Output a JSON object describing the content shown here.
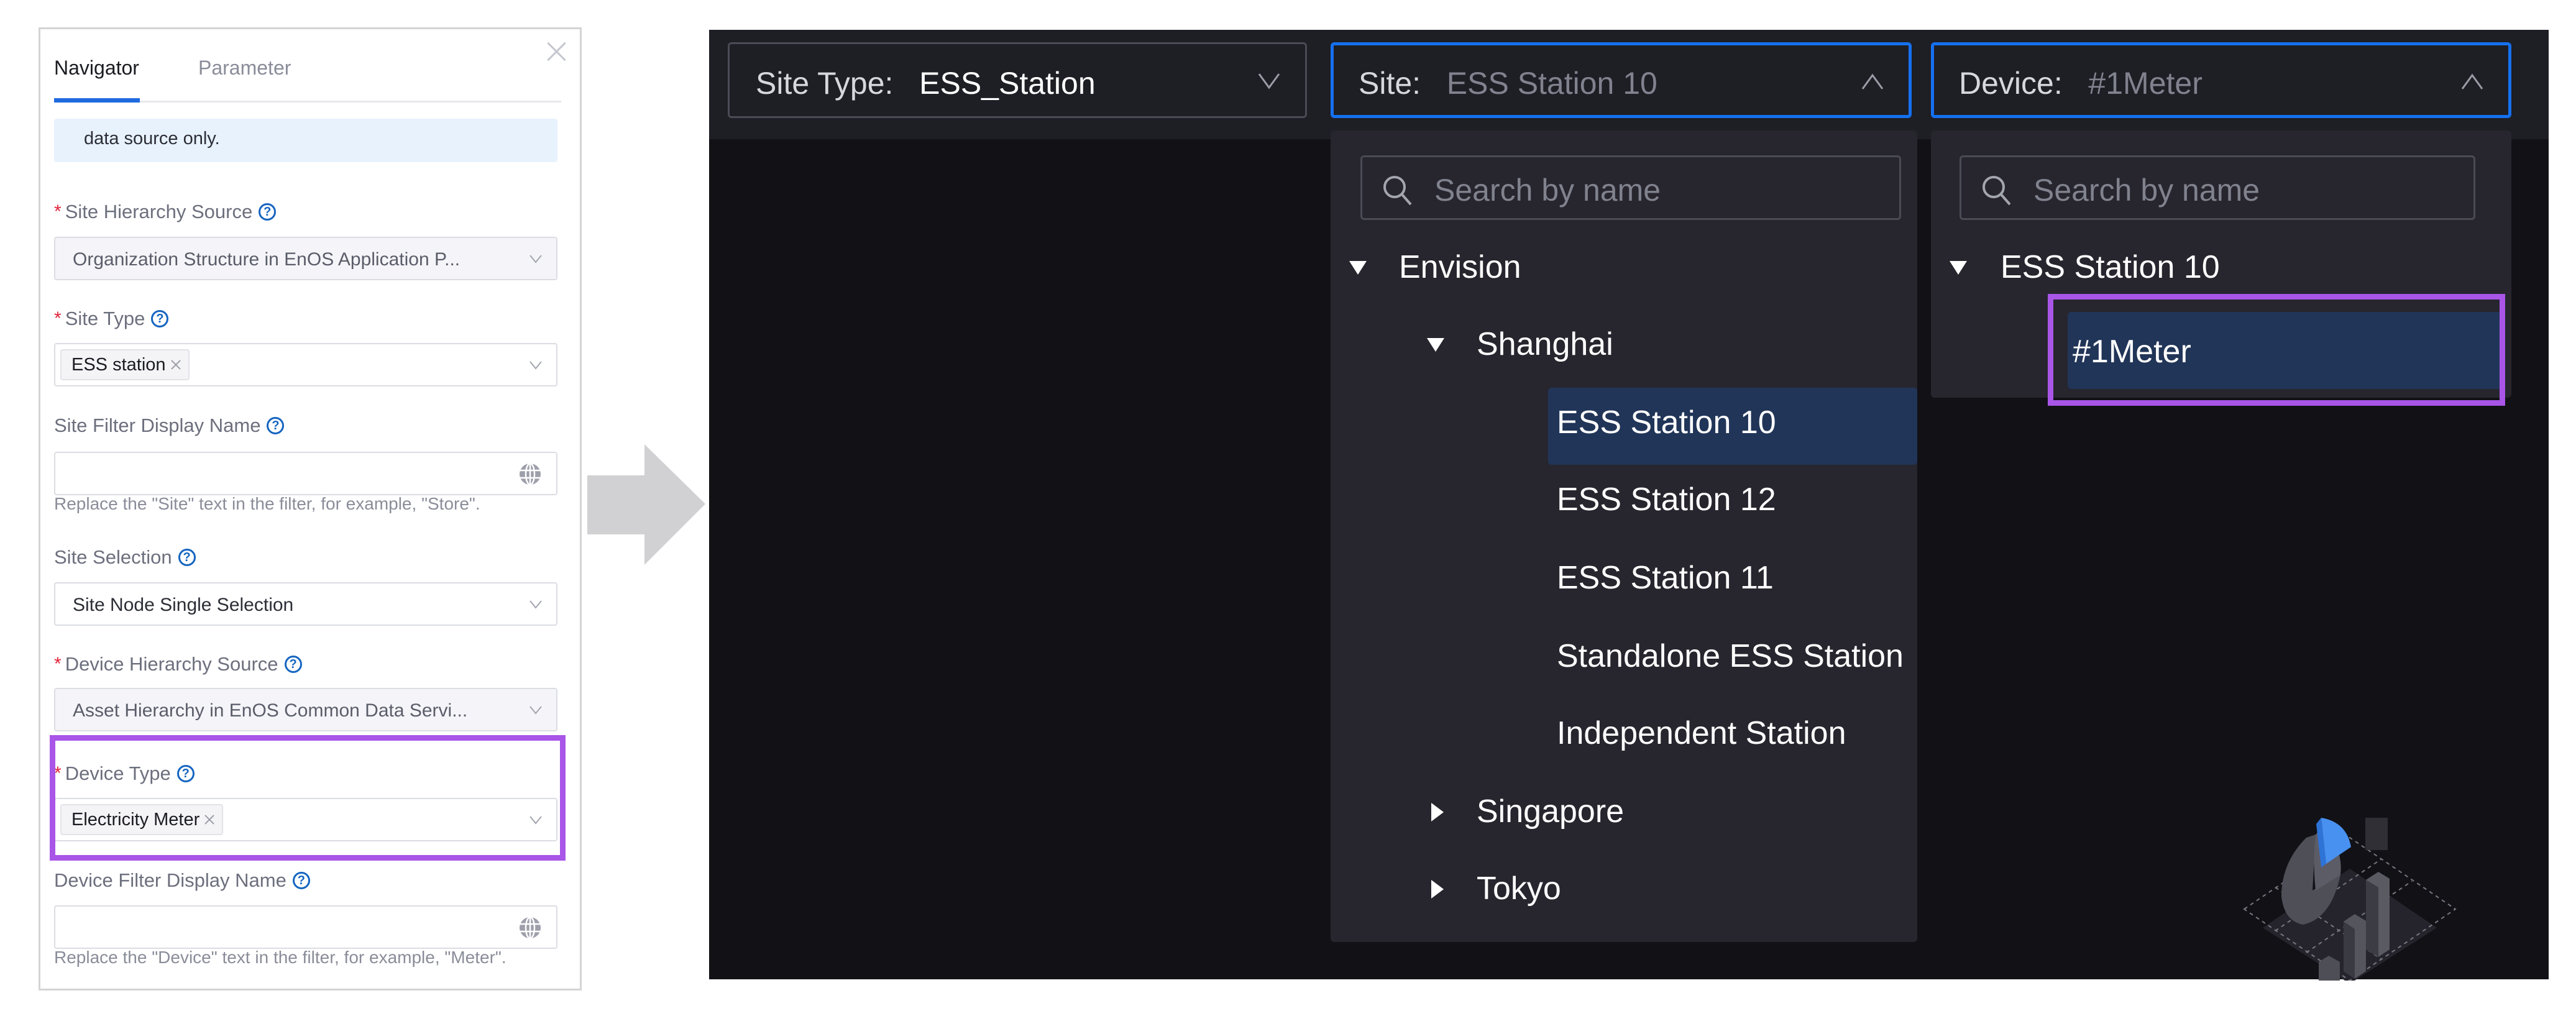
{
  "config_panel": {
    "tabs": [
      {
        "label": "Navigator",
        "active": true
      },
      {
        "label": "Parameter",
        "active": false
      }
    ],
    "info_text": "data source only.",
    "fields": {
      "site_hierarchy_source": {
        "label": "Site Hierarchy Source",
        "required": true,
        "value": "Organization Structure in EnOS Application P...",
        "disabled": true
      },
      "site_type": {
        "label": "Site Type",
        "required": true,
        "tags": [
          "ESS station"
        ]
      },
      "site_filter_display_name": {
        "label": "Site Filter Display Name",
        "required": false,
        "value": "",
        "hint": "Replace the \"Site\" text in the filter, for example, \"Store\"."
      },
      "site_selection": {
        "label": "Site Selection",
        "required": false,
        "value": "Site Node Single Selection"
      },
      "device_hierarchy_source": {
        "label": "Device Hierarchy Source",
        "required": true,
        "value": "Asset Hierarchy in EnOS Common Data Servi...",
        "disabled": true
      },
      "device_type": {
        "label": "Device Type",
        "required": true,
        "tags": [
          "Electricity Meter"
        ],
        "highlighted": true
      },
      "device_filter_display_name": {
        "label": "Device Filter Display Name",
        "required": false,
        "value": "",
        "hint": "Replace the \"Device\" text in the filter, for example, \"Meter\"."
      }
    }
  },
  "preview": {
    "filters": {
      "site_type": {
        "label": "Site Type:",
        "value": "ESS_Station",
        "open": false
      },
      "site": {
        "label": "Site:",
        "value": "ESS Station 10",
        "open": true
      },
      "device": {
        "label": "Device:",
        "value": "#1Meter",
        "open": true
      }
    },
    "site_dropdown": {
      "search_placeholder": "Search by name",
      "tree": {
        "root": {
          "label": "Envision",
          "expanded": true
        },
        "shanghai": {
          "label": "Shanghai",
          "expanded": true
        },
        "stations": [
          "ESS Station 10",
          "ESS Station 12",
          "ESS Station 11",
          "Standalone ESS Station",
          "Independent Station"
        ],
        "selected": "ESS Station 10",
        "singapore": {
          "label": "Singapore",
          "expanded": false
        },
        "tokyo": {
          "label": "Tokyo",
          "expanded": false
        }
      }
    },
    "device_dropdown": {
      "search_placeholder": "Search by name",
      "tree": {
        "root": {
          "label": "ESS Station 10",
          "expanded": true
        },
        "devices": [
          "#1Meter"
        ],
        "selected": "#1Meter"
      }
    }
  },
  "colors": {
    "accent_blue": "#1570ef",
    "highlight_purple": "#a855e8",
    "selected_row": "#213558",
    "required_red": "#e0263b"
  }
}
